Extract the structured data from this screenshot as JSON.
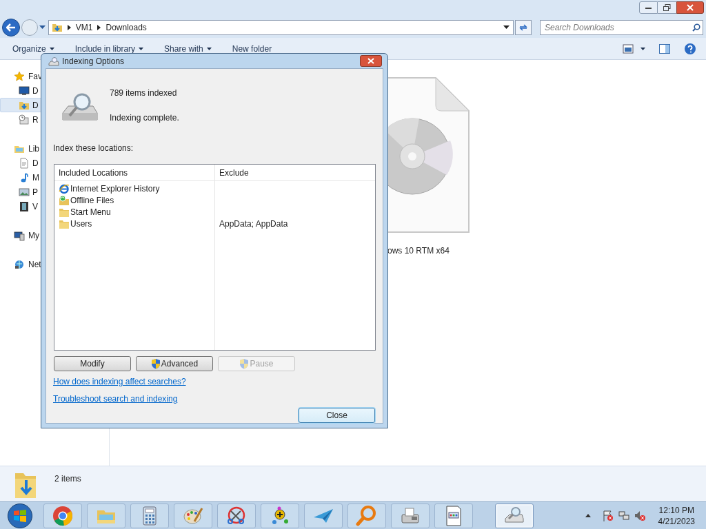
{
  "explorer": {
    "address": {
      "crumbs": [
        "VM1",
        "Downloads"
      ]
    },
    "search": {
      "placeholder": "Search Downloads"
    },
    "toolbar": [
      {
        "label": "Organize",
        "dropdown": true
      },
      {
        "label": "Include in library",
        "dropdown": true
      },
      {
        "label": "Share with",
        "dropdown": true
      },
      {
        "label": "New folder",
        "dropdown": false
      }
    ],
    "sidebar": [
      {
        "label": "Fav",
        "kind": "star",
        "items": [
          {
            "label": "D",
            "kind": "desktop",
            "selected": false
          },
          {
            "label": "D",
            "kind": "downloads",
            "selected": true
          },
          {
            "label": "R",
            "kind": "recent",
            "selected": false
          }
        ]
      },
      {
        "label": "Lib",
        "kind": "library",
        "items": [
          {
            "label": "D",
            "kind": "documents",
            "selected": false
          },
          {
            "label": "M",
            "kind": "music",
            "selected": false
          },
          {
            "label": "P",
            "kind": "pictures",
            "selected": false
          },
          {
            "label": "V",
            "kind": "videos",
            "selected": false
          }
        ]
      },
      {
        "label": "My",
        "kind": "computer"
      },
      {
        "label": "Net",
        "kind": "network"
      }
    ],
    "file": {
      "label": "ows 10 RTM x64"
    },
    "details": {
      "count": "2 items"
    }
  },
  "dialog": {
    "title": "Indexing Options",
    "status": [
      "789 items indexed",
      "Indexing complete."
    ],
    "locations_label": "Index these locations:",
    "columns": [
      "Included Locations",
      "Exclude"
    ],
    "rows": [
      {
        "location": "Internet Explorer History",
        "kind": "ie"
      },
      {
        "location": "Offline Files",
        "kind": "sync-folder"
      },
      {
        "location": "Start Menu",
        "kind": "folder"
      },
      {
        "location": "Users",
        "kind": "folder",
        "exclude": "AppData; AppData"
      }
    ],
    "buttons": [
      {
        "label": "Modify",
        "shield": false,
        "disabled": false
      },
      {
        "label": "Advanced",
        "shield": true,
        "disabled": false
      },
      {
        "label": "Pause",
        "shield": true,
        "disabled": true
      }
    ],
    "links": [
      "How does indexing affect searches?",
      "Troubleshoot search and indexing"
    ],
    "close": "Close"
  },
  "taskbar": {
    "apps": [
      {
        "kind": "chrome",
        "running": false
      },
      {
        "kind": "explorer",
        "running": false
      },
      {
        "kind": "calculator",
        "running": false
      },
      {
        "kind": "paint",
        "running": false
      },
      {
        "kind": "scissors",
        "running": false
      },
      {
        "kind": "molecule",
        "running": false
      },
      {
        "kind": "plane",
        "running": false
      },
      {
        "kind": "magnifier",
        "running": false
      },
      {
        "kind": "fax",
        "running": false
      },
      {
        "kind": "document",
        "running": false
      },
      {
        "kind": "indexing",
        "running": true
      }
    ],
    "time": "12:10 PM",
    "date": "4/21/2023"
  }
}
